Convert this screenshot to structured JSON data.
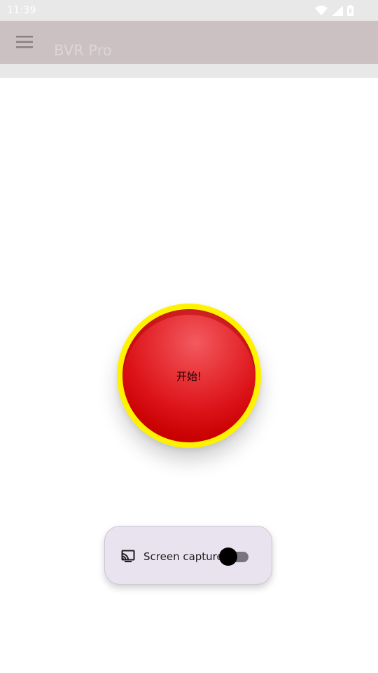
{
  "status_bar": {
    "time": "11:39",
    "icons": [
      "wifi-icon",
      "cellular-signal-icon",
      "battery-icon"
    ]
  },
  "app_bar": {
    "title": "BVR Pro",
    "menu_icon": "hamburger-menu-icon"
  },
  "main": {
    "start_button_label": "开始!",
    "screen_capture": {
      "icon": "cast-icon",
      "label": "Screen capture",
      "toggle_on": false
    }
  },
  "colors": {
    "status_bar": "#e8e8e8",
    "app_bar": "#cbc0c2",
    "button_ring": "#fff200",
    "button_red": "#dc141a",
    "card_bg": "#e9e3ef",
    "toggle_track": "#7a7480",
    "toggle_thumb": "#000000"
  }
}
